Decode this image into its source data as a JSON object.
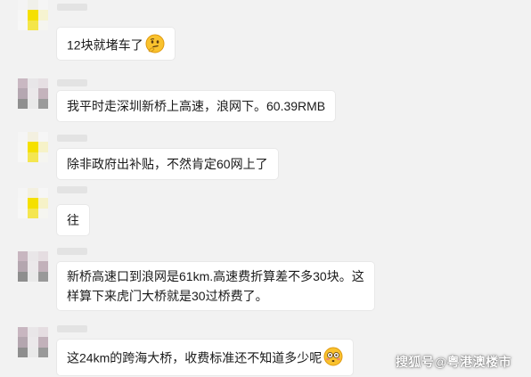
{
  "colors": {
    "background": "#f2f2f2",
    "bubble": "#ffffff"
  },
  "messages": [
    {
      "avatar": "yellow-avatar",
      "text": "12块就堵车了",
      "emoji": "thinking-face-icon"
    },
    {
      "avatar": "gray-avatar",
      "text": "我平时走深圳新桥上高速，浪网下。60.39RMB"
    },
    {
      "avatar": "yellow-avatar",
      "text": "除非政府出补贴，不然肯定60网上了"
    },
    {
      "avatar": "yellow-avatar",
      "text": "往"
    },
    {
      "avatar": "gray-avatar",
      "lines": [
        "新桥高速口到浪网是61km.高速费折算差不多30块。这",
        "样算下来虎门大桥就是30过桥费了。"
      ]
    },
    {
      "avatar": "gray-avatar",
      "text": "这24km的跨海大桥，收费标准还不知道多少呢",
      "emoji": "flushed-face-icon"
    }
  ],
  "watermark": "搜狐号@粤港澳楼市"
}
